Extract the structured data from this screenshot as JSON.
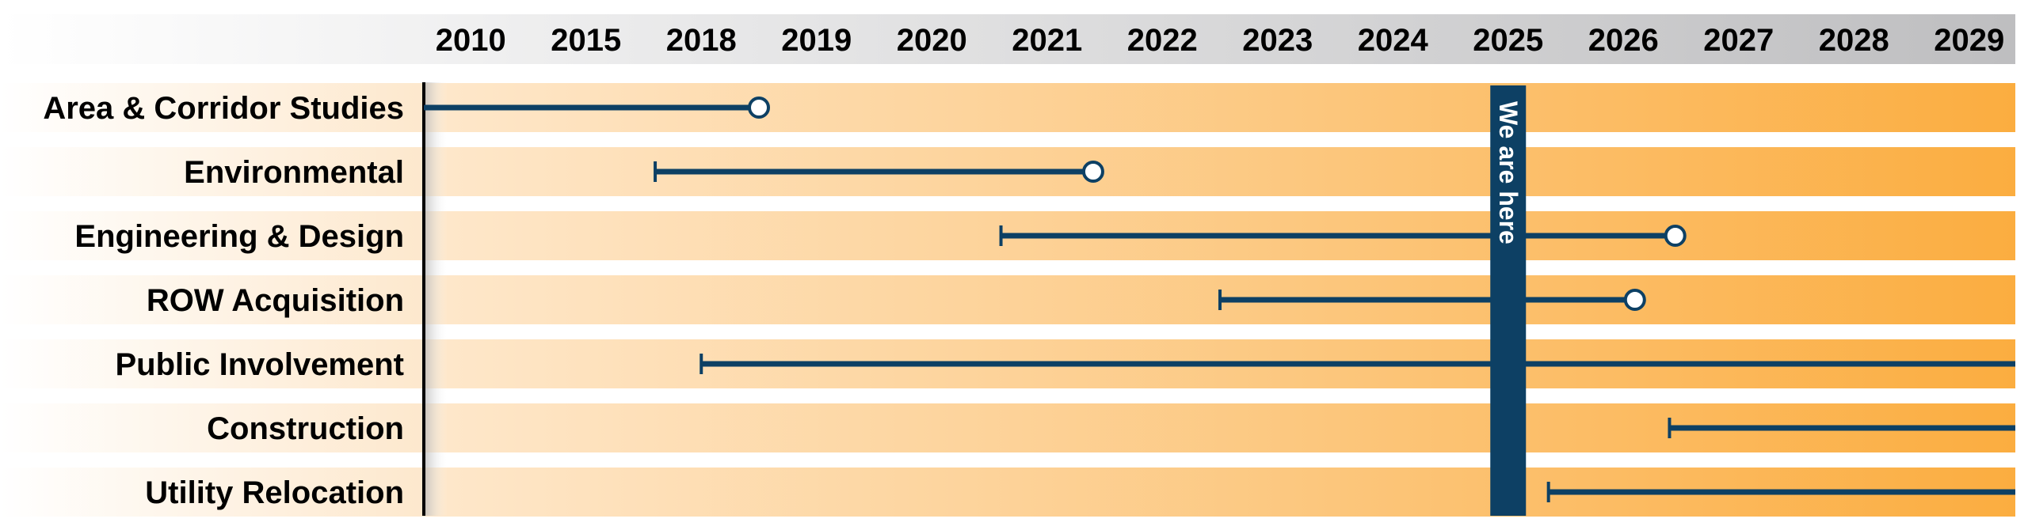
{
  "chart_data": {
    "type": "timeline",
    "title": "",
    "categories": [
      "2010",
      "2015",
      "2018",
      "2019",
      "2020",
      "2021",
      "2022",
      "2023",
      "2024",
      "2025",
      "2026",
      "2027",
      "2028",
      "2029"
    ],
    "series": [
      {
        "name": "Area & Corridor Studies",
        "start": 2010.0,
        "end": 2019.0,
        "end_marker": "circle",
        "ongoing": false
      },
      {
        "name": "Environmental",
        "start": 2018.1,
        "end": 2021.9,
        "end_marker": "circle",
        "ongoing": false
      },
      {
        "name": "Engineering & Design",
        "start": 2021.1,
        "end": 2026.95,
        "end_marker": "circle",
        "ongoing": false
      },
      {
        "name": "ROW Acquisition",
        "start": 2023.0,
        "end": 2026.6,
        "end_marker": "circle",
        "ongoing": false
      },
      {
        "name": "Public Involvement",
        "start": 2018.5,
        "end": null,
        "end_marker": "none",
        "ongoing": true
      },
      {
        "name": "Construction",
        "start": 2026.9,
        "end": null,
        "end_marker": "none",
        "ongoing": true
      },
      {
        "name": "Utility Relocation",
        "start": 2025.85,
        "end": null,
        "end_marker": "none",
        "ongoing": true
      }
    ],
    "marker": {
      "label": "We are here",
      "value": 2025.5
    },
    "colors": {
      "line": "#0d4064",
      "row_start": "#fee8cc",
      "row_end": "#fbad40",
      "header_start": "#ffffff",
      "header_end": "#bebec0"
    },
    "grid": false,
    "legend": "none"
  }
}
